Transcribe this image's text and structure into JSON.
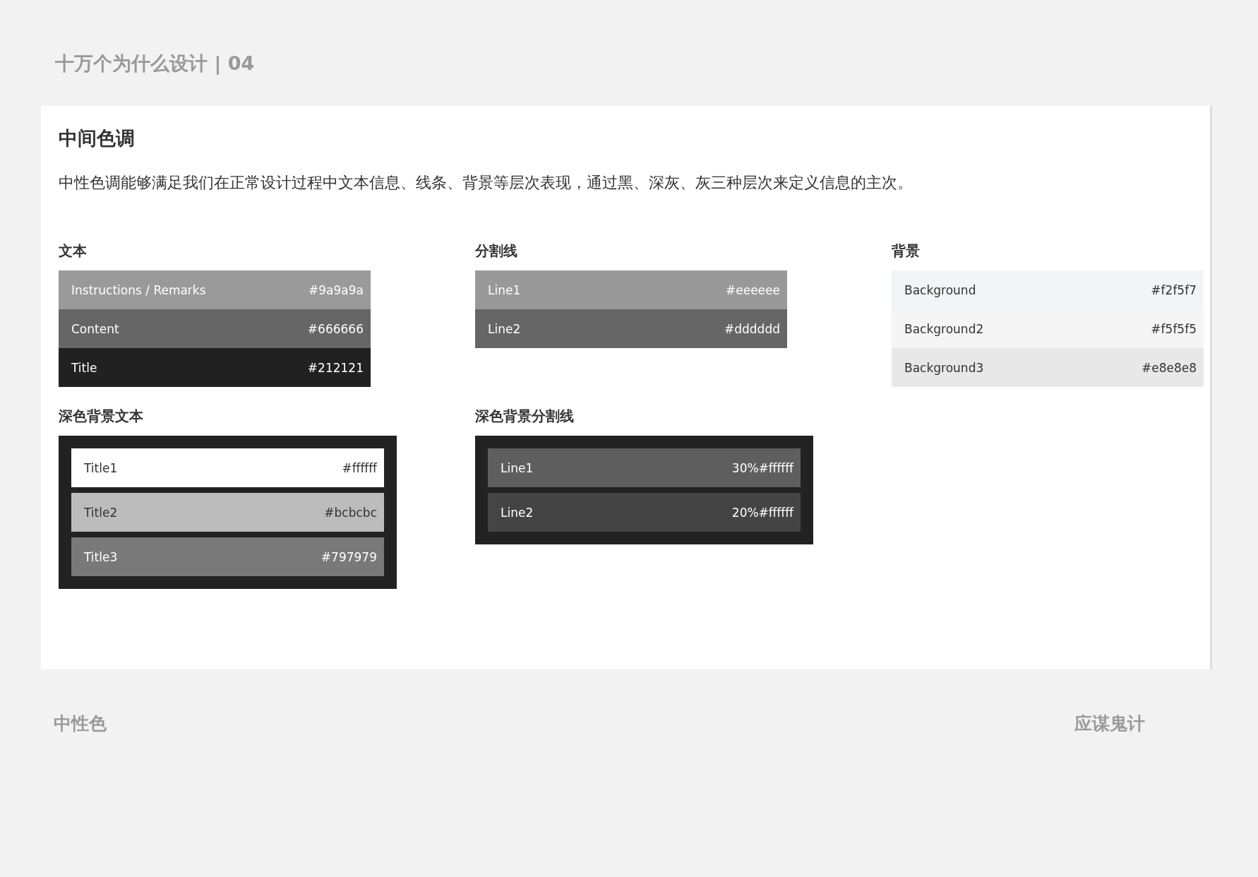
{
  "header": {
    "title": "十万个为什么设计 | 04"
  },
  "card": {
    "title": "中间色调",
    "description": "中性色调能够满足我们在正常设计过程中文本信息、线条、背景等层次表现，通过黑、深灰、灰三种层次来定义信息的主次。",
    "sections": [
      {
        "label": "文本",
        "kind": "plain",
        "swatches": [
          {
            "name": "Instructions / Remarks",
            "value": "#9a9a9a",
            "color": "#9a9a9a"
          },
          {
            "name": "Content",
            "value": "#666666",
            "color": "#666666"
          },
          {
            "name": "Title",
            "value": "#212121",
            "color": "#212121"
          }
        ]
      },
      {
        "label": "分割线",
        "kind": "plain",
        "swatches": [
          {
            "name": "Line1",
            "value": "#eeeeee",
            "color": "#999999"
          },
          {
            "name": "Line2",
            "value": "#dddddd",
            "color": "#666666"
          }
        ]
      },
      {
        "label": "背景",
        "kind": "plain",
        "swatches": [
          {
            "name": "Background",
            "value": "#f2f5f7",
            "color": "#f2f5f7"
          },
          {
            "name": "Background2",
            "value": "#f5f5f5",
            "color": "#f5f5f5"
          },
          {
            "name": "Background3",
            "value": "#e8e8e8",
            "color": "#e8e8e8"
          }
        ]
      },
      {
        "label": "深色背景文本",
        "kind": "dark",
        "swatches": [
          {
            "name": "Title1",
            "value": "#ffffff",
            "color": "#ffffff"
          },
          {
            "name": "Title2",
            "value": "#bcbcbc",
            "color": "#bcbcbc"
          },
          {
            "name": "Title3",
            "value": "#797979",
            "color": "#797979"
          }
        ]
      },
      {
        "label": "深色背景分割线",
        "kind": "dark",
        "swatches": [
          {
            "name": "Line1",
            "value": "30%#ffffff",
            "color": "#5e5e5e"
          },
          {
            "name": "Line2",
            "value": "20%#ffffff",
            "color": "#444444"
          }
        ]
      }
    ]
  },
  "footer": {
    "left": "中性色",
    "right": "应谋鬼计"
  }
}
